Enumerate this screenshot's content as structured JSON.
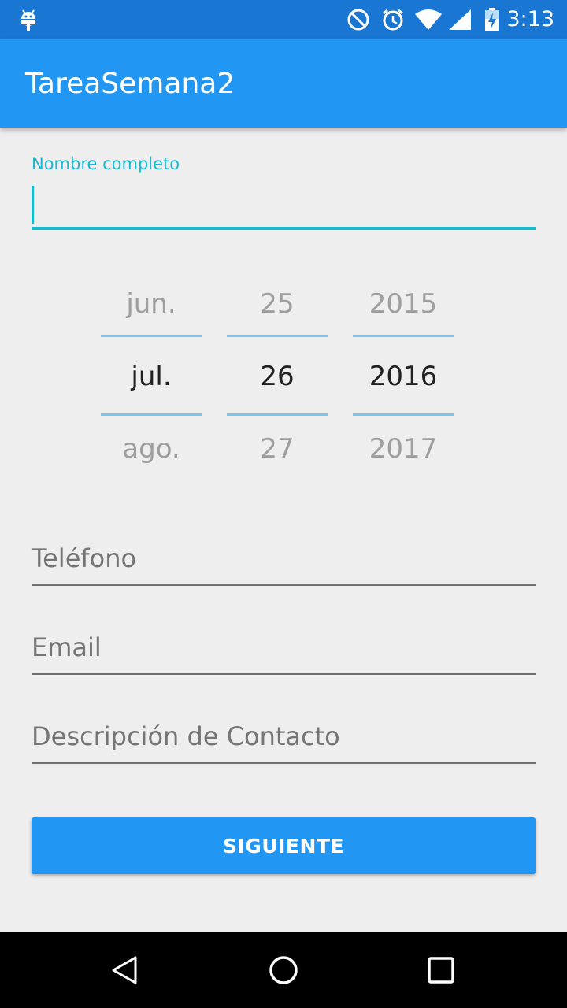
{
  "status_bar": {
    "time": "3:13",
    "icons": [
      "android-debug-icon",
      "do-not-disturb-icon",
      "alarm-icon",
      "wifi-icon",
      "cell-signal-icon",
      "battery-charging-icon"
    ]
  },
  "app_bar": {
    "title": "TareaSemana2"
  },
  "form": {
    "name_label": "Nombre completo",
    "name_value": "",
    "date_picker": {
      "month": {
        "prev": "jun.",
        "current": "jul.",
        "next": "ago."
      },
      "day": {
        "prev": "25",
        "current": "26",
        "next": "27"
      },
      "year": {
        "prev": "2015",
        "current": "2016",
        "next": "2017"
      }
    },
    "phone_placeholder": "Teléfono",
    "email_placeholder": "Email",
    "description_placeholder": "Descripción de Contacto",
    "next_button": "SIGUIENTE"
  },
  "nav_bar": {
    "icons": [
      "back-icon",
      "home-icon",
      "recents-icon"
    ]
  },
  "colors": {
    "status_bar": "#1976d2",
    "app_bar": "#2196f3",
    "accent": "#17b9cd",
    "background": "#eeeeee",
    "button": "#2196f3"
  }
}
